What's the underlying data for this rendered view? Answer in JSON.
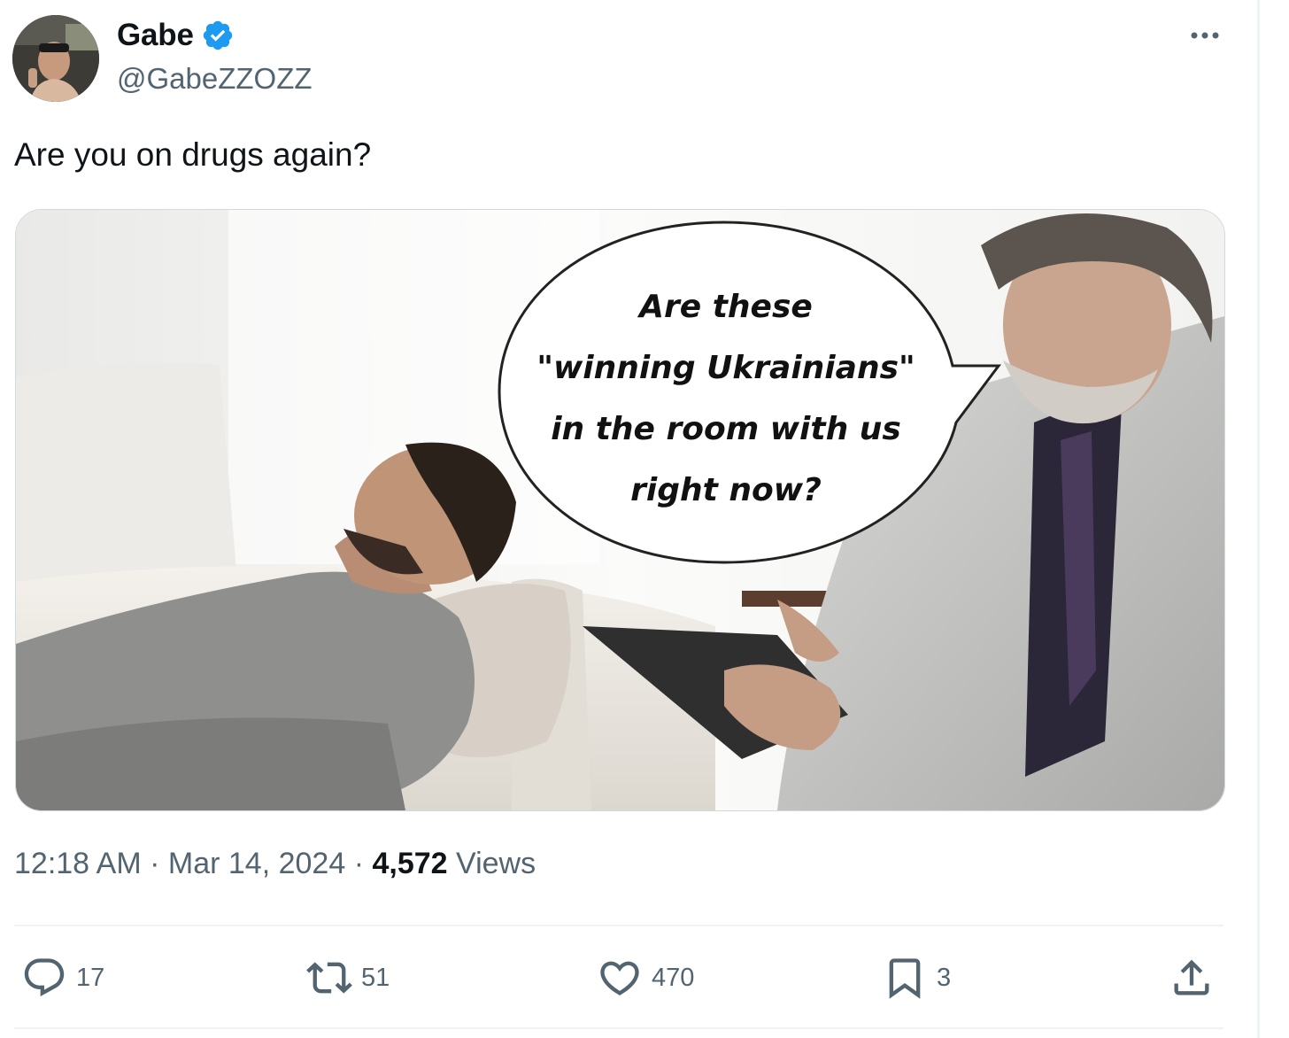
{
  "author": {
    "name": "Gabe",
    "handle": "@GabeZZOZZ"
  },
  "tweet": {
    "text": "Are you on drugs again?",
    "image_caption_lines": [
      "Are these",
      "\"winning Ukrainians\"",
      "in the room with us",
      "right now?"
    ],
    "meta": {
      "time": "12:18 AM",
      "separator": "·",
      "date": "Mar 14, 2024",
      "views_count": "4,572",
      "views_label": "Views"
    }
  },
  "actions": {
    "replies": "17",
    "reposts": "51",
    "likes": "470",
    "bookmarks": "3"
  },
  "icons": {
    "verified": "verified-badge-icon",
    "more": "more-options-icon",
    "reply": "reply-icon",
    "repost": "repost-icon",
    "like": "heart-icon",
    "bookmark": "bookmark-icon",
    "share": "share-icon"
  },
  "colors": {
    "verified_blue": "#1d9bf0",
    "secondary_text": "#536471",
    "primary_text": "#0f1419"
  }
}
